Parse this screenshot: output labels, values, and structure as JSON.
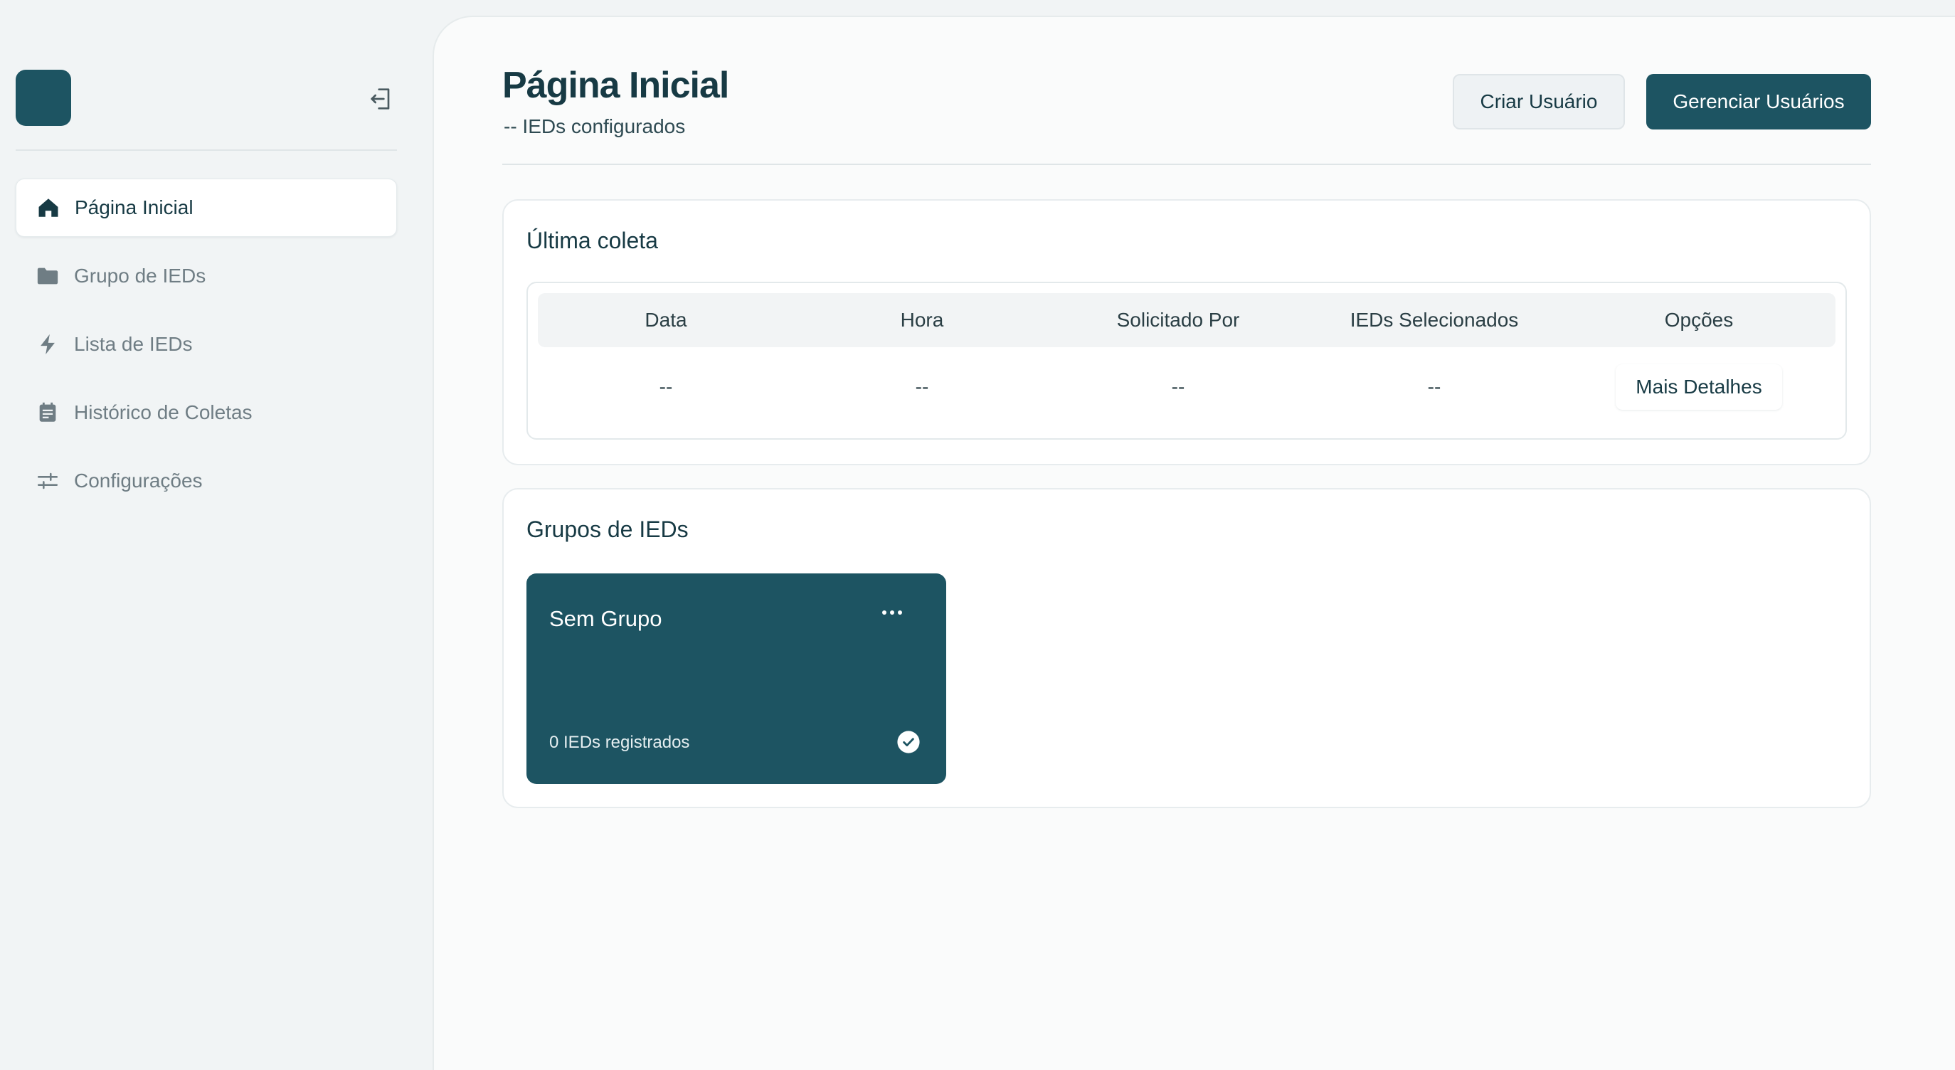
{
  "sidebar": {
    "logout_icon": "logout-icon",
    "items": [
      {
        "label": "Página Inicial",
        "icon": "home-icon",
        "active": true
      },
      {
        "label": "Grupo de IEDs",
        "icon": "folder-icon",
        "active": false
      },
      {
        "label": "Lista de IEDs",
        "icon": "lightning-icon",
        "active": false
      },
      {
        "label": "Histórico de Coletas",
        "icon": "calendar-icon",
        "active": false
      },
      {
        "label": "Configurações",
        "icon": "sliders-icon",
        "active": false
      }
    ]
  },
  "header": {
    "title": "Página Inicial",
    "subtitle": "-- IEDs configurados",
    "create_user_label": "Criar Usuário",
    "manage_users_label": "Gerenciar Usuários"
  },
  "last_collection": {
    "title": "Última coleta",
    "columns": [
      "Data",
      "Hora",
      "Solicitado Por",
      "IEDs Selecionados",
      "Opções"
    ],
    "row": {
      "data": "--",
      "hora": "--",
      "solicitado_por": "--",
      "ieds_selecionados": "--",
      "details_label": "Mais Detalhes"
    }
  },
  "groups": {
    "title": "Grupos de IEDs",
    "items": [
      {
        "name": "Sem Grupo",
        "count_label": "0 IEDs registrados",
        "menu_icon": "more-horizontal-icon",
        "status_icon": "check-circle-icon"
      }
    ]
  },
  "colors": {
    "brand": "#1d5462",
    "background": "#f1f4f5",
    "panel": "#fafbfb",
    "text": "#173a44"
  }
}
